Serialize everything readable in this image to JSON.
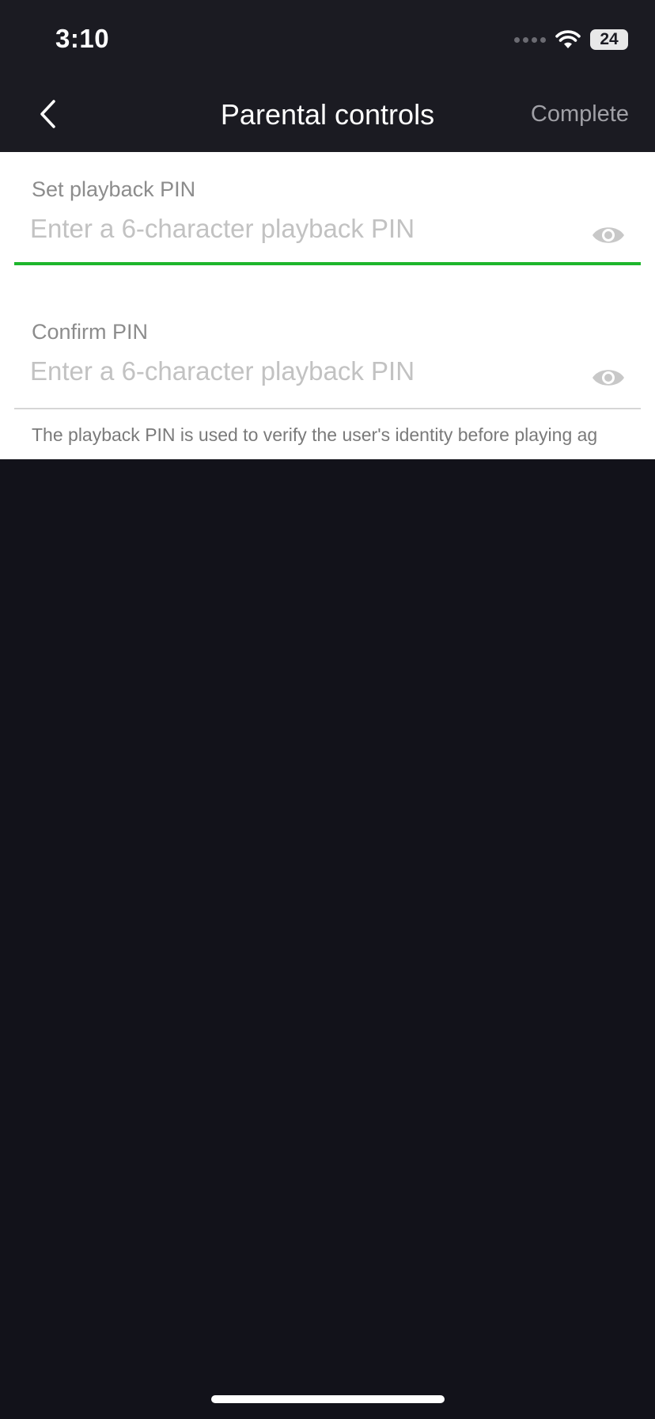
{
  "status_bar": {
    "time": "3:10",
    "battery": "24",
    "icons": [
      "cellular-dots-icon",
      "wifi-icon",
      "battery-icon"
    ]
  },
  "nav": {
    "back_icon": "chevron-left-icon",
    "title": "Parental controls",
    "complete_label": "Complete"
  },
  "form": {
    "set_pin": {
      "label": "Set playback PIN",
      "placeholder": "Enter a 6-character playback PIN",
      "value": "",
      "icon": "eye-icon"
    },
    "confirm_pin": {
      "label": "Confirm PIN",
      "placeholder": "Enter a 6-character playback PIN",
      "value": "",
      "icon": "eye-icon"
    },
    "hint": "The playback PIN is used to verify the user's identity before playing ag"
  },
  "colors": {
    "header_bg": "#1b1b22",
    "page_bg": "#12121a",
    "accent_green": "#1db62c",
    "muted_text": "#8c8c8c"
  }
}
